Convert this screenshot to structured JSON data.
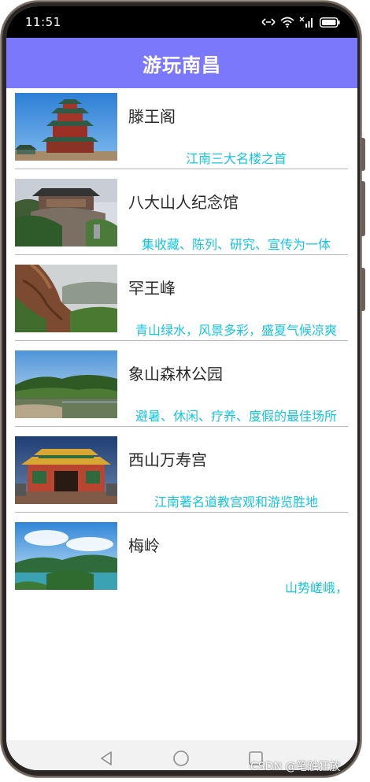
{
  "status_bar": {
    "time": "11:51",
    "icons": [
      "nfc-icon",
      "wifi-icon",
      "signal-x-icon",
      "battery-icon"
    ]
  },
  "app_bar": {
    "title": "游玩南昌",
    "color": "#7c78fb"
  },
  "places": [
    {
      "name": "滕王阁",
      "description": "江南三大名楼之首",
      "image": "pavilion-photo"
    },
    {
      "name": "八大山人纪念馆",
      "description": "集收藏、陈列、研究、宣传为一体",
      "image": "memorial-hall-photo"
    },
    {
      "name": "罕王峰",
      "description": "青山绿水，风景多彩，盛夏气候凉爽",
      "image": "mountain-cliff-photo"
    },
    {
      "name": "象山森林公园",
      "description": "避暑、休闲、疗养、度假的最佳场所",
      "image": "forest-lake-photo"
    },
    {
      "name": "西山万寿宫",
      "description": "江南著名道教宫观和游览胜地",
      "image": "temple-gate-photo"
    },
    {
      "name": "梅岭",
      "description": "山势嵯峨，",
      "image": "mountain-lake-photo"
    }
  ],
  "nav_bar": {
    "buttons": [
      "back-triangle-icon",
      "home-circle-icon",
      "recents-square-icon"
    ]
  },
  "watermark": "CSDN @笔触狂放",
  "colors": {
    "accent": "#7c78fb",
    "description_text": "#16c6dc",
    "title_text": "#2a2a2a"
  }
}
